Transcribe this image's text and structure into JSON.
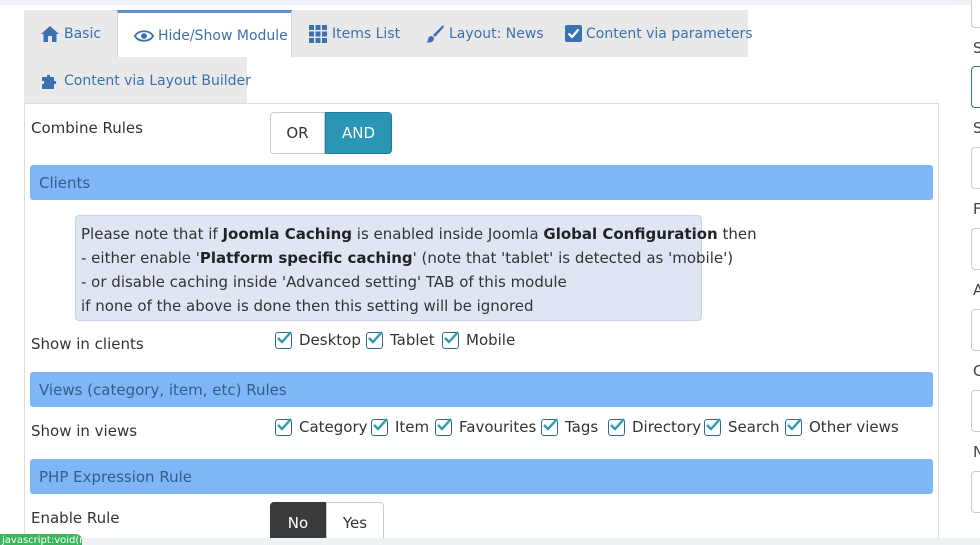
{
  "tabs": [
    {
      "label": "Basic",
      "icon": "home-icon"
    },
    {
      "label": "Hide/Show Module",
      "icon": "eye-icon",
      "active": true
    },
    {
      "label": "Items List",
      "icon": "grid-icon"
    },
    {
      "label": "Layout: News",
      "icon": "brush-icon"
    },
    {
      "label": "Content via parameters",
      "icon": "checkbox-icon"
    },
    {
      "label": "Content via Layout Builder",
      "icon": "puzzle-icon"
    }
  ],
  "combine": {
    "label": "Combine Rules",
    "options": [
      "OR",
      "AND"
    ],
    "selected": "AND"
  },
  "sections": {
    "clients": "Clients",
    "views": "Views (category, item, etc) Rules",
    "php": "PHP Expression Rule"
  },
  "note": {
    "line1_pre": "Please note that if ",
    "line1_b1": "Joomla Caching",
    "line1_mid": " is enabled inside Joomla ",
    "line1_b2": "Global Configuration",
    "line1_post": " then",
    "line2_pre": "- either enable '",
    "line2_b": "Platform specific caching",
    "line2_post": "' (note that 'tablet' is detected as 'mobile')",
    "line3": "- or disable caching inside 'Advanced setting' TAB of this module",
    "line4": "if none of the above is done then this setting will be ignored"
  },
  "clients": {
    "label": "Show in clients",
    "options": [
      {
        "label": "Desktop",
        "checked": true
      },
      {
        "label": "Tablet",
        "checked": true
      },
      {
        "label": "Mobile",
        "checked": true
      }
    ]
  },
  "views": {
    "label": "Show in views",
    "options": [
      {
        "label": "Category",
        "checked": true
      },
      {
        "label": "Item",
        "checked": true
      },
      {
        "label": "Favourites",
        "checked": true
      },
      {
        "label": "Tags",
        "checked": true
      },
      {
        "label": "Directory",
        "checked": true
      },
      {
        "label": "Search",
        "checked": true
      },
      {
        "label": "Other views",
        "checked": true
      }
    ]
  },
  "enable_rule": {
    "label": "Enable Rule",
    "options": [
      "No",
      "Yes"
    ],
    "selected": "No"
  },
  "right_letters": [
    "S",
    "S",
    "F",
    "A",
    "C",
    "N"
  ],
  "status_text": "javascript:void(null);",
  "colors": {
    "accent": "#2b95b5",
    "section": "#7fb6f5",
    "tab_text": "#3a71b0",
    "note_bg": "#dfe6f3"
  }
}
